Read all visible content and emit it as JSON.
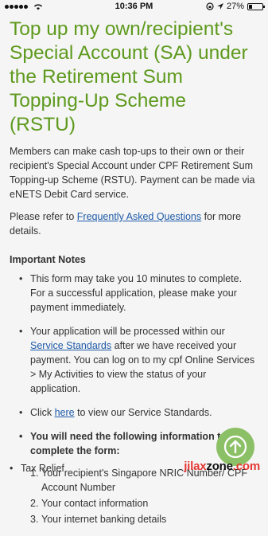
{
  "status_bar": {
    "time": "10:36 PM",
    "battery": "27%",
    "battery_level": 0.27
  },
  "heading": "Top up my own/recipient's Special Account (SA) under the Retirement Sum Topping-Up Scheme (RSTU)",
  "intro": "Members can make cash top-ups to their own or their recipient's Special Account under CPF Retirement Sum Topping-up Scheme (RSTU). Payment can be made via eNETS Debit Card service.",
  "refer": {
    "prefix": "Please refer to ",
    "link": "Frequently Asked Questions",
    "suffix": " for more details."
  },
  "notes": {
    "title": "Important Notes",
    "item1": "This form may take you 10 minutes to complete. For a successful application, please make your payment immediately.",
    "item2": {
      "prefix": "Your application will be processed within our ",
      "link": "Service Standards",
      "suffix": " after we have received your payment. You can log on to my cpf Online Services > My Activities to view the status of your application."
    },
    "item3": {
      "prefix": "Click ",
      "link": "here",
      "suffix": " to view our Service Standards."
    },
    "item4": {
      "text": "You will need the following information to complete the form:",
      "list": [
        {
          "num": "1.",
          "text": "Your recipient's Singapore NRIC Number/ CPF Account Number"
        },
        {
          "num": "2.",
          "text": "Your contact information"
        },
        {
          "num": "3.",
          "text": "Your internet banking details"
        }
      ]
    },
    "tax_relief": "Tax Relief"
  },
  "watermark": {
    "part1": "jilax",
    "part2": "zone",
    "part3": ".com"
  },
  "colors": {
    "heading": "#5e9a1e",
    "link": "#1e5aa8",
    "fab": "#8cc066",
    "watermark": "#e53935"
  },
  "icons": {
    "scroll_top": "arrow-up-icon",
    "wifi": "wifi-icon",
    "battery": "battery-icon"
  }
}
